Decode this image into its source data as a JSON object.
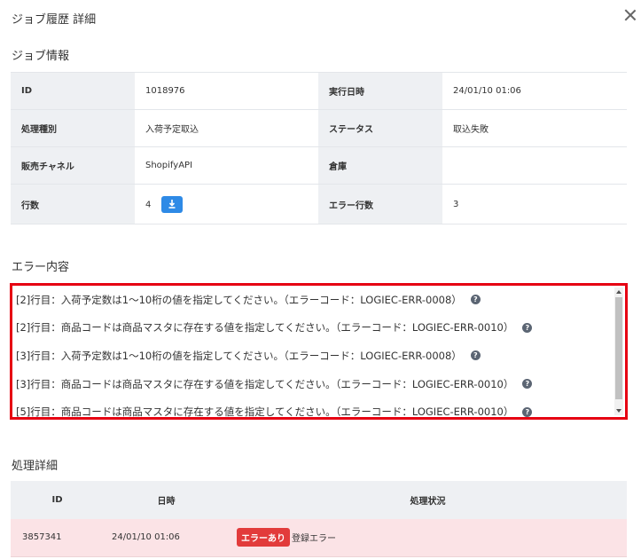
{
  "dialog": {
    "title": "ジョブ履歴 詳細"
  },
  "job_info": {
    "heading": "ジョブ情報",
    "rows": [
      {
        "label1": "ID",
        "value1": "1018976",
        "label2": "実行日時",
        "value2": "24/01/10 01:06"
      },
      {
        "label1": "処理種別",
        "value1": "入荷予定取込",
        "label2": "ステータス",
        "value2": "取込失敗"
      },
      {
        "label1": "販売チャネル",
        "value1": "ShopifyAPI",
        "label2": "倉庫",
        "value2": ""
      },
      {
        "label1": "行数",
        "value1": "4",
        "label2": "エラー行数",
        "value2": "3"
      }
    ]
  },
  "errors": {
    "heading": "エラー内容",
    "items": [
      "[2]行目：入荷予定数は1〜10桁の値を指定してください。（エラーコード：LOGIEC-ERR-0008）",
      "[2]行目：商品コードは商品マスタに存在する値を指定してください。（エラーコード：LOGIEC-ERR-0010）",
      "[3]行目：入荷予定数は1〜10桁の値を指定してください。（エラーコード：LOGIEC-ERR-0008）",
      "[3]行目：商品コードは商品マスタに存在する値を指定してください。（エラーコード：LOGIEC-ERR-0010）",
      "[5]行目：商品コードは商品マスタに存在する値を指定してください。（エラーコード：LOGIEC-ERR-0010）"
    ],
    "help_glyph": "?"
  },
  "processing": {
    "heading": "処理詳細",
    "columns": [
      "ID",
      "日時",
      "処理状況"
    ],
    "rows": [
      {
        "id": "3857341",
        "datetime": "24/01/10 01:06",
        "badge": "エラーあり",
        "status": "登録エラー"
      }
    ]
  },
  "colors": {
    "accent": "#2e8ae6",
    "error_border": "#e60012",
    "badge": "#e23b3b",
    "error_row": "#fbe3e6",
    "label_bg": "#eef0f3"
  },
  "icons": {
    "close": "close-icon",
    "download": "download-icon",
    "help": "help-icon"
  }
}
